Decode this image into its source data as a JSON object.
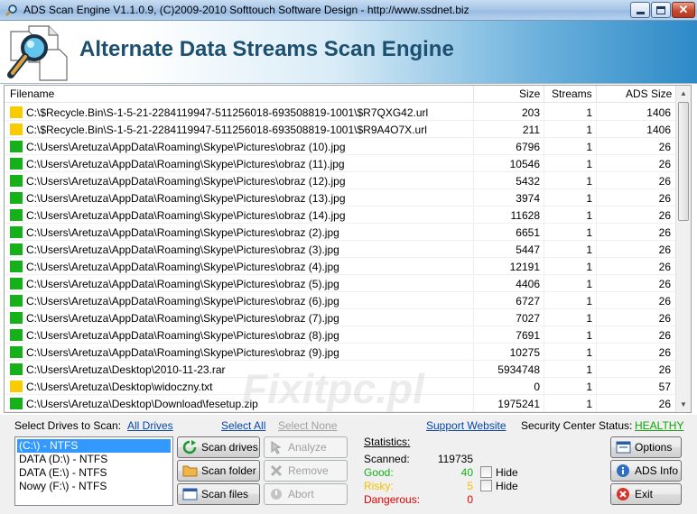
{
  "window": {
    "title": "ADS Scan Engine V1.1.0.9, (C)2009-2010 Softtouch Software Design - http://www.ssdnet.biz"
  },
  "header": {
    "app_title": "Alternate Data Streams Scan Engine"
  },
  "list": {
    "columns": {
      "filename": "Filename",
      "size": "Size",
      "streams": "Streams",
      "ads_size": "ADS Size"
    },
    "rows": [
      {
        "status": "risky",
        "filename": "C:\\$Recycle.Bin\\S-1-5-21-2284119947-511256018-693508819-1001\\$R7QXG42.url",
        "size": "203",
        "streams": "1",
        "ads_size": "1406"
      },
      {
        "status": "risky",
        "filename": "C:\\$Recycle.Bin\\S-1-5-21-2284119947-511256018-693508819-1001\\$R9A4O7X.url",
        "size": "211",
        "streams": "1",
        "ads_size": "1406"
      },
      {
        "status": "good",
        "filename": "C:\\Users\\Aretuza\\AppData\\Roaming\\Skype\\Pictures\\obraz (10).jpg",
        "size": "6796",
        "streams": "1",
        "ads_size": "26"
      },
      {
        "status": "good",
        "filename": "C:\\Users\\Aretuza\\AppData\\Roaming\\Skype\\Pictures\\obraz (11).jpg",
        "size": "10546",
        "streams": "1",
        "ads_size": "26"
      },
      {
        "status": "good",
        "filename": "C:\\Users\\Aretuza\\AppData\\Roaming\\Skype\\Pictures\\obraz (12).jpg",
        "size": "5432",
        "streams": "1",
        "ads_size": "26"
      },
      {
        "status": "good",
        "filename": "C:\\Users\\Aretuza\\AppData\\Roaming\\Skype\\Pictures\\obraz (13).jpg",
        "size": "3974",
        "streams": "1",
        "ads_size": "26"
      },
      {
        "status": "good",
        "filename": "C:\\Users\\Aretuza\\AppData\\Roaming\\Skype\\Pictures\\obraz (14).jpg",
        "size": "11628",
        "streams": "1",
        "ads_size": "26"
      },
      {
        "status": "good",
        "filename": "C:\\Users\\Aretuza\\AppData\\Roaming\\Skype\\Pictures\\obraz (2).jpg",
        "size": "6651",
        "streams": "1",
        "ads_size": "26"
      },
      {
        "status": "good",
        "filename": "C:\\Users\\Aretuza\\AppData\\Roaming\\Skype\\Pictures\\obraz (3).jpg",
        "size": "5447",
        "streams": "1",
        "ads_size": "26"
      },
      {
        "status": "good",
        "filename": "C:\\Users\\Aretuza\\AppData\\Roaming\\Skype\\Pictures\\obraz (4).jpg",
        "size": "12191",
        "streams": "1",
        "ads_size": "26"
      },
      {
        "status": "good",
        "filename": "C:\\Users\\Aretuza\\AppData\\Roaming\\Skype\\Pictures\\obraz (5).jpg",
        "size": "4406",
        "streams": "1",
        "ads_size": "26"
      },
      {
        "status": "good",
        "filename": "C:\\Users\\Aretuza\\AppData\\Roaming\\Skype\\Pictures\\obraz (6).jpg",
        "size": "6727",
        "streams": "1",
        "ads_size": "26"
      },
      {
        "status": "good",
        "filename": "C:\\Users\\Aretuza\\AppData\\Roaming\\Skype\\Pictures\\obraz (7).jpg",
        "size": "7027",
        "streams": "1",
        "ads_size": "26"
      },
      {
        "status": "good",
        "filename": "C:\\Users\\Aretuza\\AppData\\Roaming\\Skype\\Pictures\\obraz (8).jpg",
        "size": "7691",
        "streams": "1",
        "ads_size": "26"
      },
      {
        "status": "good",
        "filename": "C:\\Users\\Aretuza\\AppData\\Roaming\\Skype\\Pictures\\obraz (9).jpg",
        "size": "10275",
        "streams": "1",
        "ads_size": "26"
      },
      {
        "status": "good",
        "filename": "C:\\Users\\Aretuza\\Desktop\\2010-11-23.rar",
        "size": "5934748",
        "streams": "1",
        "ads_size": "26"
      },
      {
        "status": "risky",
        "filename": "C:\\Users\\Aretuza\\Desktop\\widoczny.txt",
        "size": "0",
        "streams": "1",
        "ads_size": "57"
      },
      {
        "status": "good",
        "filename": "C:\\Users\\Aretuza\\Desktop\\Download\\fesetup.zip",
        "size": "1975241",
        "streams": "1",
        "ads_size": "26"
      }
    ]
  },
  "watermark": "Fixitpc.pl",
  "status_colors": {
    "good": "#16b01a",
    "risky": "#f8cc00",
    "dangerous": "#e00000"
  },
  "drives": {
    "label": "Select Drives to Scan:",
    "all_drives_link": "All Drives",
    "select_all": "Select All",
    "select_none": "Select None",
    "items": [
      "(C:\\) - NTFS",
      "DATA (D:\\) - NTFS",
      "DATA (E:\\) - NTFS",
      "Nowy (F:\\) - NTFS"
    ],
    "selected_index": 0
  },
  "buttons": {
    "scan_drives": "Scan drives",
    "scan_folder": "Scan folder",
    "scan_files": "Scan files",
    "analyze": "Analyze",
    "remove": "Remove",
    "abort": "Abort",
    "options": "Options",
    "ads_info": "ADS Info",
    "exit": "Exit"
  },
  "links": {
    "support_website": "Support Website",
    "security_center_label": "Security Center Status:",
    "security_center_status": "HEALTHY"
  },
  "statistics": {
    "title": "Statistics:",
    "scanned_label": "Scanned:",
    "scanned_value": "119735",
    "good_label": "Good:",
    "good_value": "40",
    "risky_label": "Risky:",
    "risky_value": "5",
    "dangerous_label": "Dangerous:",
    "dangerous_value": "0",
    "hide_label": "Hide"
  }
}
